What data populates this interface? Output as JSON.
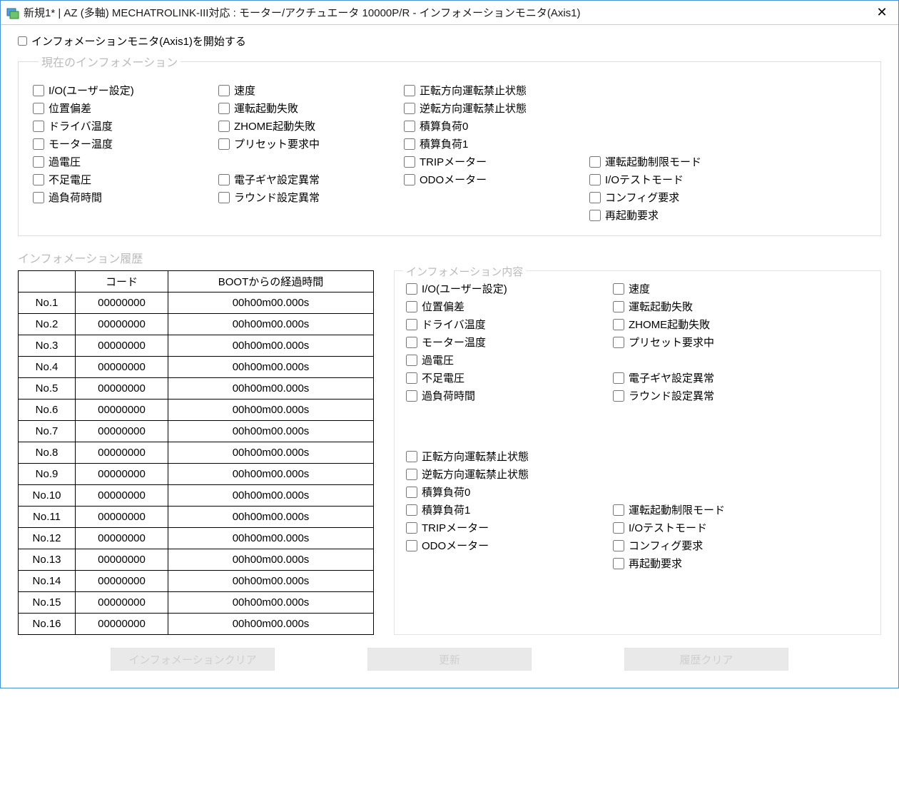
{
  "window": {
    "title": "新規1* | AZ (多軸) MECHATROLINK-III対応 : モーター/アクチュエータ 10000P/R - インフォメーションモニタ(Axis1)"
  },
  "start_checkbox_label": "インフォメーションモニタ(Axis1)を開始する",
  "group_current": {
    "legend": "現在のインフォメーション",
    "col1": [
      "I/O(ユーザー設定)",
      "位置偏差",
      "ドライバ温度",
      "モーター温度",
      "過電圧",
      "不足電圧",
      "過負荷時間"
    ],
    "col2": [
      "速度",
      "運転起動失敗",
      "ZHOME起動失敗",
      "プリセット要求中",
      "",
      "電子ギヤ設定異常",
      "ラウンド設定異常"
    ],
    "col3": [
      "正転方向運転禁止状態",
      "逆転方向運転禁止状態",
      "積算負荷0",
      "積算負荷1",
      "TRIPメーター",
      "ODOメーター"
    ],
    "col4": [
      "",
      "",
      "",
      "",
      "運転起動制限モード",
      "I/Oテストモード",
      "コンフィグ要求",
      "再起動要求"
    ]
  },
  "group_history": {
    "legend": "インフォメーション履歴",
    "table_headers": {
      "blank": "",
      "code": "コード",
      "time": "BOOTからの経過時間"
    },
    "rows": [
      {
        "no": "No.1",
        "code": "00000000",
        "time": "00h00m00.000s"
      },
      {
        "no": "No.2",
        "code": "00000000",
        "time": "00h00m00.000s"
      },
      {
        "no": "No.3",
        "code": "00000000",
        "time": "00h00m00.000s"
      },
      {
        "no": "No.4",
        "code": "00000000",
        "time": "00h00m00.000s"
      },
      {
        "no": "No.5",
        "code": "00000000",
        "time": "00h00m00.000s"
      },
      {
        "no": "No.6",
        "code": "00000000",
        "time": "00h00m00.000s"
      },
      {
        "no": "No.7",
        "code": "00000000",
        "time": "00h00m00.000s"
      },
      {
        "no": "No.8",
        "code": "00000000",
        "time": "00h00m00.000s"
      },
      {
        "no": "No.9",
        "code": "00000000",
        "time": "00h00m00.000s"
      },
      {
        "no": "No.10",
        "code": "00000000",
        "time": "00h00m00.000s"
      },
      {
        "no": "No.11",
        "code": "00000000",
        "time": "00h00m00.000s"
      },
      {
        "no": "No.12",
        "code": "00000000",
        "time": "00h00m00.000s"
      },
      {
        "no": "No.13",
        "code": "00000000",
        "time": "00h00m00.000s"
      },
      {
        "no": "No.14",
        "code": "00000000",
        "time": "00h00m00.000s"
      },
      {
        "no": "No.15",
        "code": "00000000",
        "time": "00h00m00.000s"
      },
      {
        "no": "No.16",
        "code": "00000000",
        "time": "00h00m00.000s"
      }
    ],
    "content": {
      "legend": "インフォメーション内容",
      "upper_col1": [
        "I/O(ユーザー設定)",
        "位置偏差",
        "ドライバ温度",
        "モーター温度",
        "過電圧",
        "不足電圧",
        "過負荷時間"
      ],
      "upper_col2": [
        "速度",
        "運転起動失敗",
        "ZHOME起動失敗",
        "プリセット要求中",
        "",
        "電子ギヤ設定異常",
        "ラウンド設定異常"
      ],
      "lower_col1": [
        "正転方向運転禁止状態",
        "逆転方向運転禁止状態",
        "積算負荷0",
        "積算負荷1",
        "TRIPメーター",
        "ODOメーター"
      ],
      "lower_col2": [
        "",
        "",
        "",
        "運転起動制限モード",
        "I/Oテストモード",
        "コンフィグ要求",
        "再起動要求"
      ]
    }
  },
  "buttons": {
    "clear_info": "インフォメーションクリア",
    "refresh": "更新",
    "clear_history": "履歴クリア"
  }
}
